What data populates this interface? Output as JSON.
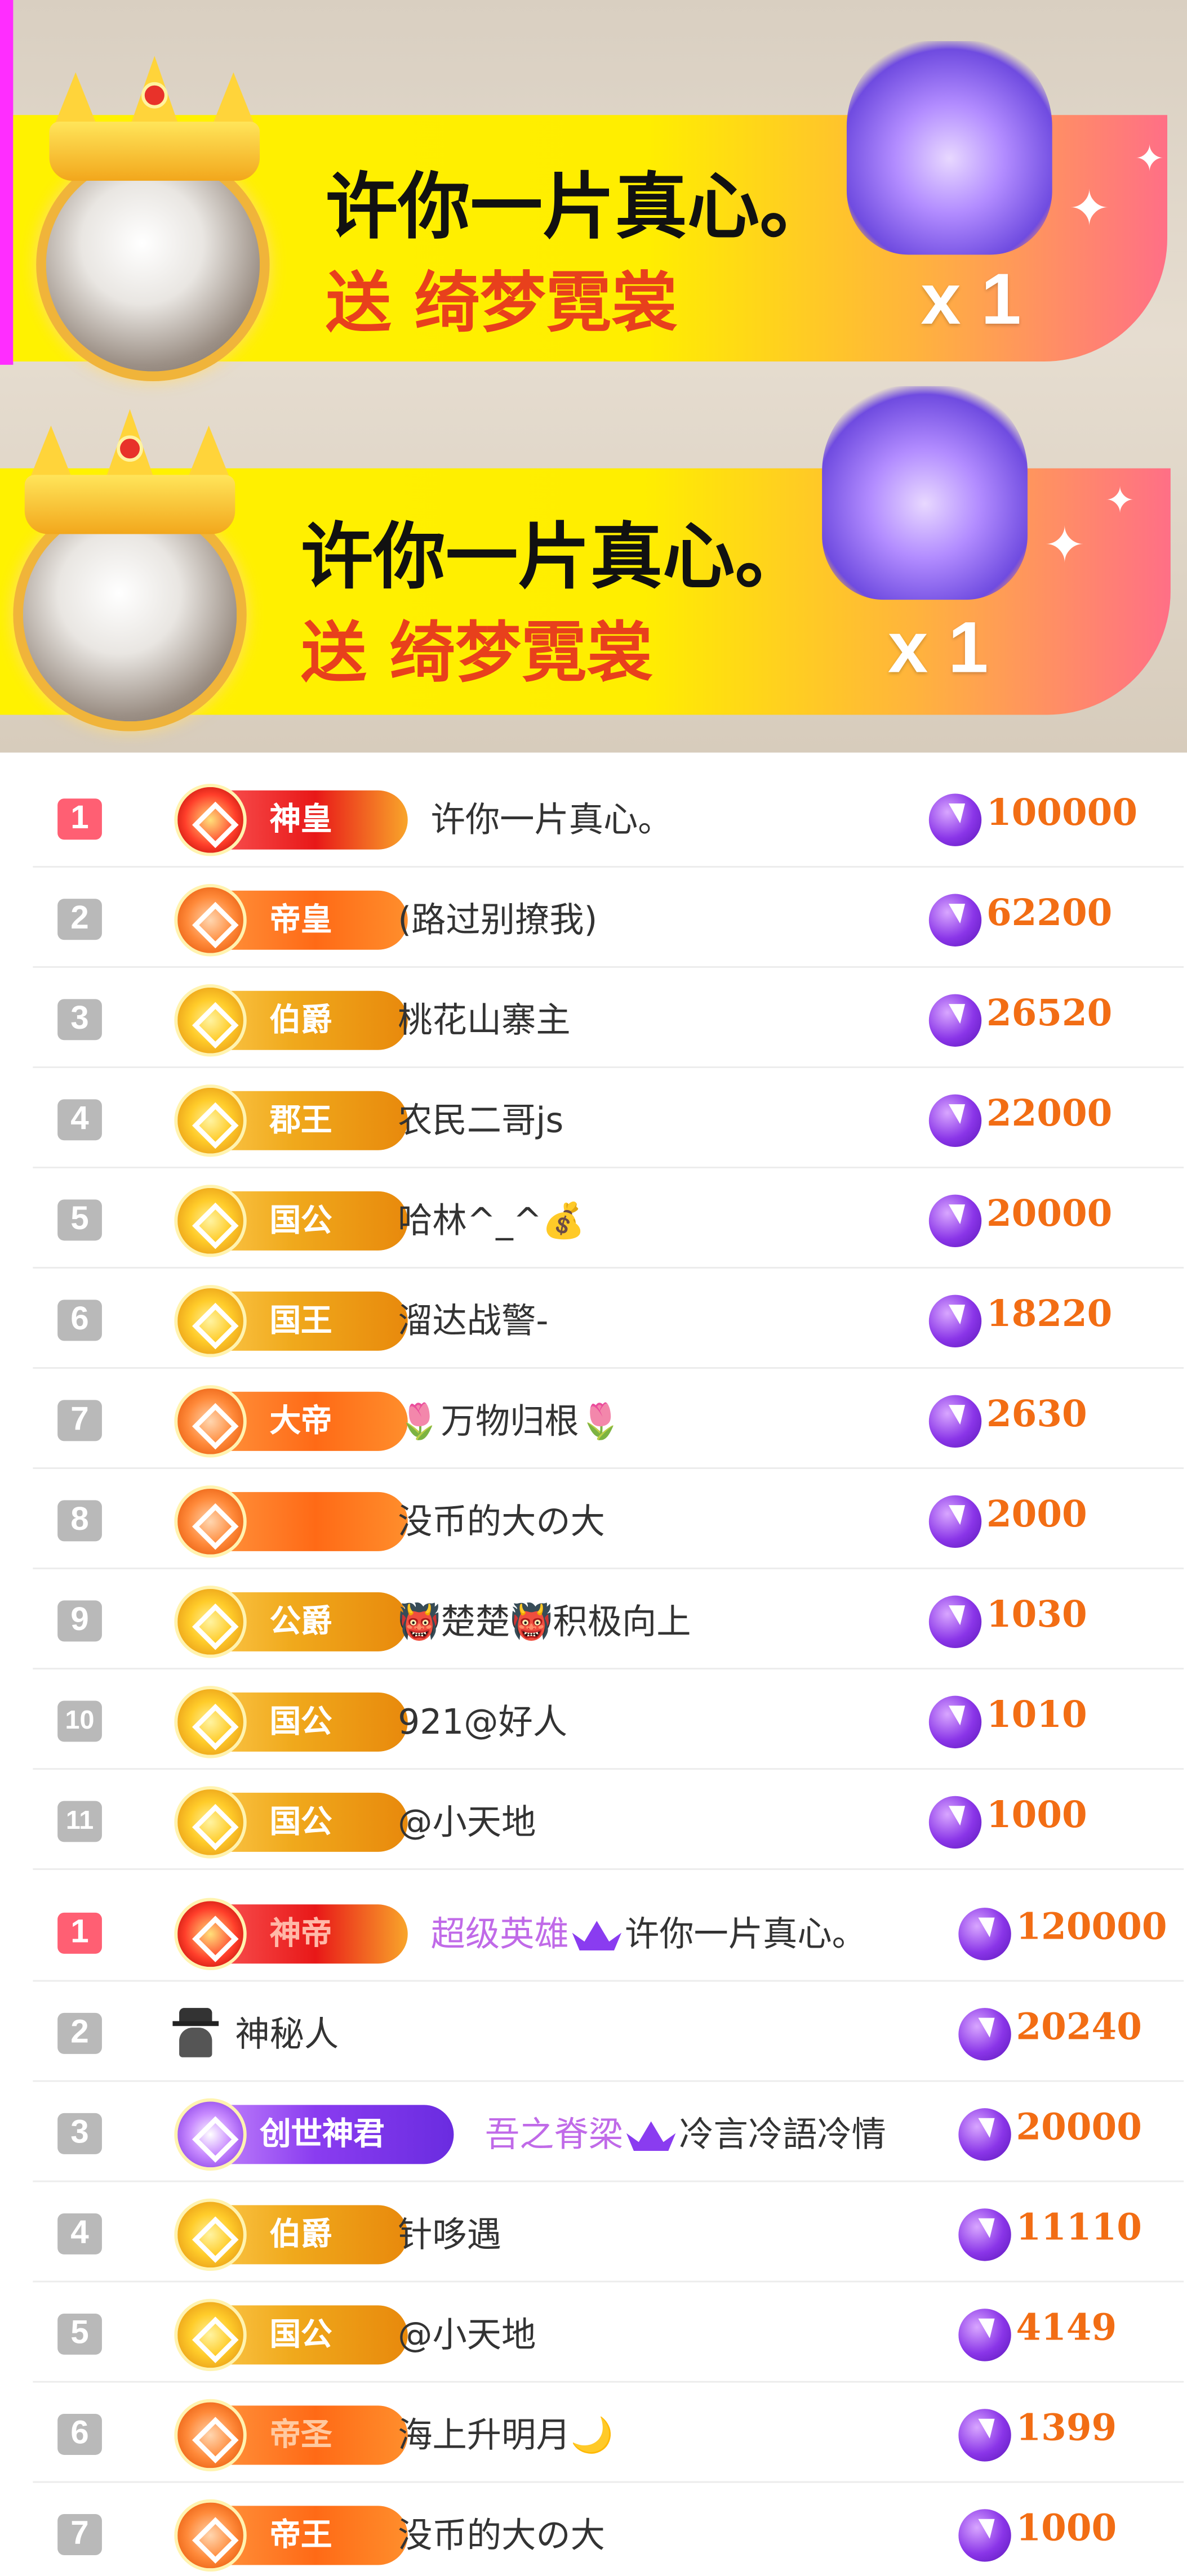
{
  "banners": [
    {
      "sender": "许你一片真心。",
      "gift_line": "送 绮梦霓裳",
      "count": "x 1"
    },
    {
      "sender": "许你一片真心。",
      "gift_line": "送 绮梦霓裳",
      "count": "x 1"
    }
  ],
  "ranking_a": [
    {
      "rank": "1",
      "badge": "神皇",
      "name": "许你一片真心。",
      "score": "100000"
    },
    {
      "rank": "2",
      "badge": "帝皇",
      "name": "(路过别撩我)",
      "score": "62200"
    },
    {
      "rank": "3",
      "badge": "伯爵",
      "name": "桃花山寨主",
      "score": "26520"
    },
    {
      "rank": "4",
      "badge": "郡王",
      "name": "农民二哥js",
      "score": "22000"
    },
    {
      "rank": "5",
      "badge": "国公",
      "name": "哈林^_^💰",
      "score": "20000"
    },
    {
      "rank": "6",
      "badge": "国王",
      "name": "溜达战警-",
      "score": "18220"
    },
    {
      "rank": "7",
      "badge": "大帝",
      "name": "🌷万物归根🌷",
      "score": "2630"
    },
    {
      "rank": "8",
      "badge": "",
      "name": "没币的大の大",
      "score": "2000"
    },
    {
      "rank": "9",
      "badge": "公爵",
      "name": "👹楚楚👹积极向上",
      "score": "1030"
    },
    {
      "rank": "10",
      "badge": "国公",
      "name": "921@好人",
      "score": "1010"
    },
    {
      "rank": "11",
      "badge": "国公",
      "name": "@小天地",
      "score": "1000"
    }
  ],
  "ranking_b": [
    {
      "rank": "1",
      "badge": "神帝",
      "name_vip": "超级英雄",
      "name": "许你一片真心。",
      "score": "120000"
    },
    {
      "rank": "2",
      "badge": "",
      "name": "神秘人",
      "score": "20240"
    },
    {
      "rank": "3",
      "badge": "创世神君",
      "name_vip": "吾之脊梁",
      "name": "冷言冷語冷情",
      "score": "20000"
    },
    {
      "rank": "4",
      "badge": "伯爵",
      "name": "针哆遇",
      "score": "11110"
    },
    {
      "rank": "5",
      "badge": "国公",
      "name": "@小天地",
      "score": "4149"
    },
    {
      "rank": "6",
      "badge": "帝圣",
      "name": "海上升明月🌙",
      "score": "1399"
    },
    {
      "rank": "7",
      "badge": "帝王",
      "name": "没币的大の大",
      "score": "1000"
    }
  ]
}
